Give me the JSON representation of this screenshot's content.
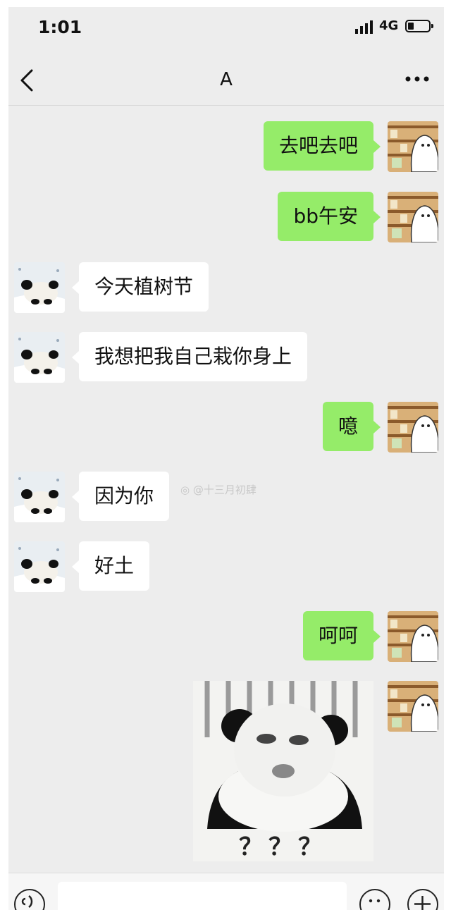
{
  "status_bar": {
    "time": "1:01",
    "network": "4G"
  },
  "header": {
    "title": "A"
  },
  "messages": [
    {
      "from": "me",
      "text": "去吧去吧"
    },
    {
      "from": "me",
      "text": "bb午安"
    },
    {
      "from": "them",
      "text": "今天植树节"
    },
    {
      "from": "them",
      "text": "我想把我自己栽你身上"
    },
    {
      "from": "me",
      "text": "噫"
    },
    {
      "from": "them",
      "text": "因为你"
    },
    {
      "from": "them",
      "text": "好土"
    },
    {
      "from": "me",
      "text": "呵呵"
    },
    {
      "from": "me",
      "sticker_text": "？？？"
    }
  ],
  "watermark": "@十三月初肆",
  "icons": {
    "back": "chevron-left-icon",
    "more": "more-dots-icon",
    "voice": "voice-icon",
    "emoji": "emoji-icon",
    "plus": "plus-icon"
  },
  "colors": {
    "my_bubble": "#95ec69",
    "their_bubble": "#ffffff",
    "background": "#ededed"
  }
}
